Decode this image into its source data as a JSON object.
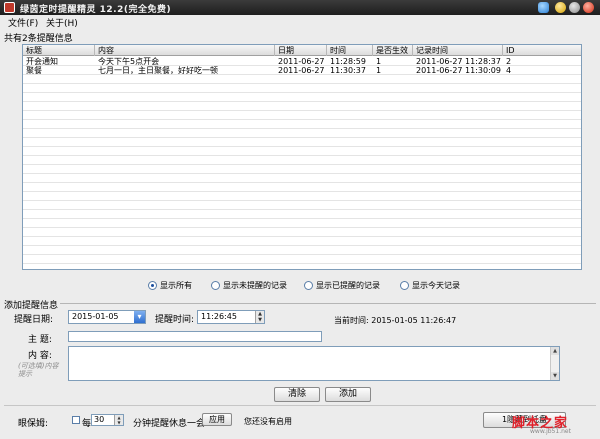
{
  "window": {
    "title": "绿茵定时提醒精灵 12.2(完全免费)"
  },
  "menu": {
    "file": "文件(F)",
    "about": "关于(H)"
  },
  "list": {
    "group_title": "共有2条提醒信息",
    "columns": [
      "标题",
      "内容",
      "日期",
      "时间",
      "是否生效",
      "记录时间",
      "ID"
    ],
    "rows": [
      {
        "title": "开会通知",
        "content": "今天下午5点开会",
        "date": "2011-06-27",
        "time": "11:28:59",
        "active": "1",
        "record_time": "2011-06-27 11:28:37",
        "id": "2"
      },
      {
        "title": "聚餐",
        "content": "七月一日，主日聚餐，好好吃一顿",
        "date": "2011-06-27",
        "time": "11:30:37",
        "active": "1",
        "record_time": "2011-06-27 11:30:09",
        "id": "4"
      }
    ]
  },
  "filters": {
    "all": "显示所有",
    "unreminded": "显示未提醒的记录",
    "reminded": "显示已提醒的记录",
    "today": "显示今天记录"
  },
  "add": {
    "group_title": "添加提醒信息",
    "date_label": "提醒日期:",
    "date_value": "2015-01-05",
    "time_label": "提醒时间:",
    "time_value": "11:26:45",
    "current_time": "当前时间: 2015-01-05 11:26:47",
    "subject_label": "主  题:",
    "content_label": "内  容:",
    "hint": "(可选填)内容提示",
    "clear_button": "清除",
    "add_button": "添加"
  },
  "eye_care": {
    "label": "眼保姆:",
    "every": "每",
    "minutes_value": "30",
    "suffix": "分钟提醒休息一会",
    "apply_button": "应用",
    "status": "您还没有启用",
    "tray_button": "1隐藏到托盘"
  },
  "watermark": {
    "text": "脚本之家",
    "url": "www.jb51.net"
  }
}
